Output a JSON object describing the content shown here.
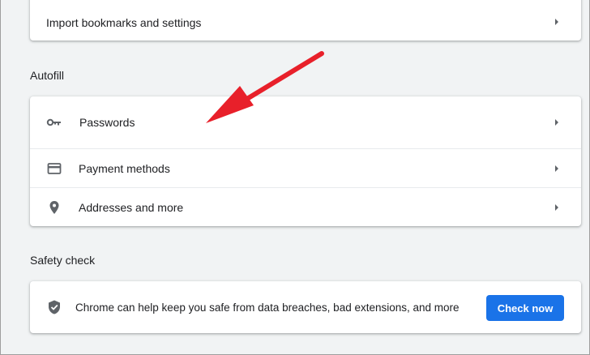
{
  "import_card": {
    "label": "Import bookmarks and settings"
  },
  "autofill": {
    "title": "Autofill",
    "items": [
      {
        "label": "Passwords",
        "icon": "key-icon"
      },
      {
        "label": "Payment methods",
        "icon": "credit-card-icon"
      },
      {
        "label": "Addresses and more",
        "icon": "location-pin-icon"
      }
    ]
  },
  "safety_check": {
    "title": "Safety check",
    "description": "Chrome can help keep you safe from data breaches, bad extensions, and more",
    "button_label": "Check now",
    "icon": "shield-check-icon"
  },
  "colors": {
    "accent": "#1a73e8",
    "annotation_arrow": "#e8202a",
    "background": "#f1f3f4",
    "card": "#ffffff",
    "icon": "#5f6368"
  }
}
